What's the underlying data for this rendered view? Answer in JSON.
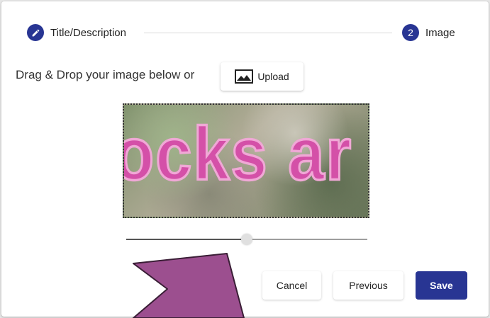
{
  "stepper": {
    "step1": {
      "icon": "pencil-icon",
      "label": "Title/Description"
    },
    "step2": {
      "number": "2",
      "label": "Image"
    }
  },
  "upload": {
    "instruction": "Drag & Drop your image below or",
    "button_label": "Upload",
    "button_icon": "image-icon"
  },
  "preview": {
    "image_text": "ocks ar"
  },
  "zoom_slider": {
    "value": 0.5
  },
  "actions": {
    "cancel_label": "Cancel",
    "previous_label": "Previous",
    "save_label": "Save"
  },
  "colors": {
    "primary": "#283593",
    "preview_text": "#d450a8",
    "pointer_arrow": "#9c4f8f"
  }
}
